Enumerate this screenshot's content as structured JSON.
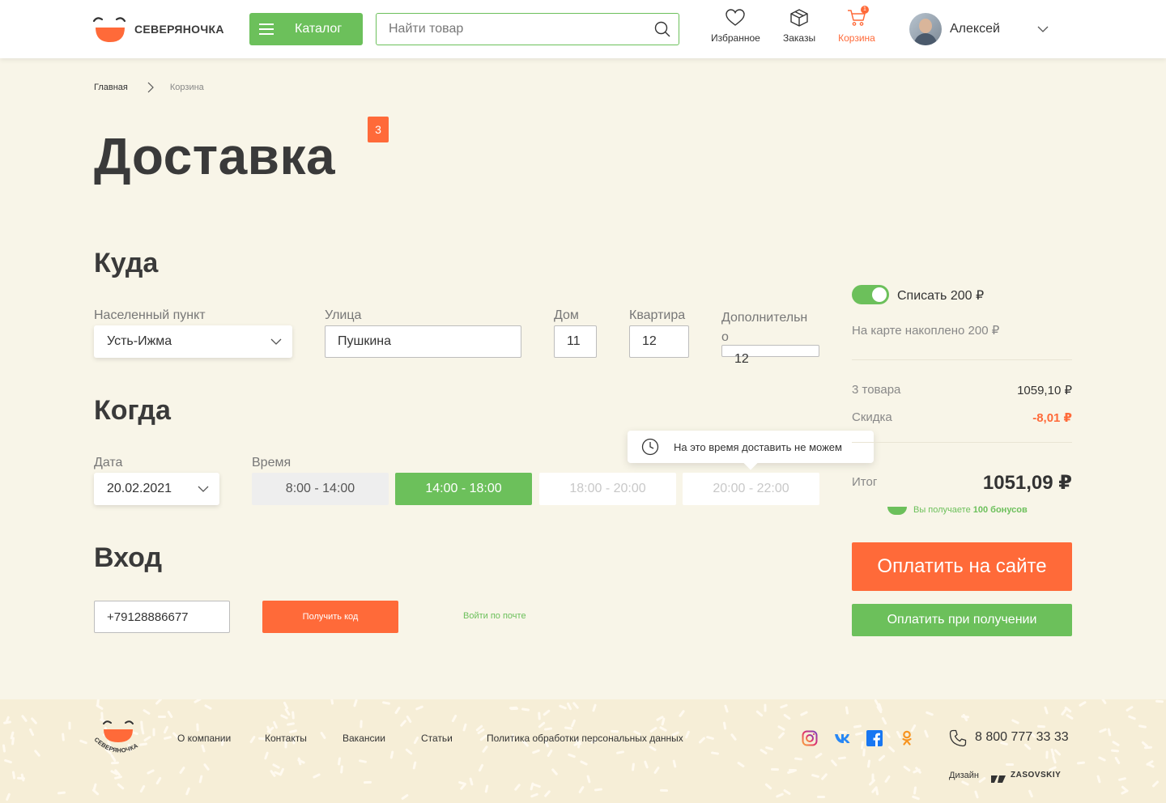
{
  "header": {
    "logo_text": "СЕВЕРЯНОЧКА",
    "catalog_label": "Каталог",
    "search_placeholder": "Найти товар",
    "nav": {
      "favorites": "Избранное",
      "orders": "Заказы",
      "cart": "Корзина",
      "cart_count": "1"
    },
    "user_name": "Алексей"
  },
  "breadcrumb": {
    "home": "Главная",
    "current": "Корзина"
  },
  "page": {
    "title": "Доставка",
    "badge": "3"
  },
  "where": {
    "heading": "Куда",
    "city_label": "Населенный пункт",
    "city_value": "Усть-Ижма",
    "street_label": "Улица",
    "street_value": "Пушкина",
    "house_label": "Дом",
    "house_value": "11",
    "apt_label": "Квартира",
    "apt_value": "12",
    "extra_label_1": "Дополнительн",
    "extra_label_2": "о",
    "extra_value": "12"
  },
  "when": {
    "heading": "Когда",
    "date_label": "Дата",
    "date_value": "20.02.2021",
    "time_label": "Время",
    "slots": [
      "8:00 - 14:00",
      "14:00 - 18:00",
      "18:00 - 20:00",
      "20:00 - 22:00"
    ],
    "tooltip": "На это время доставить не можем"
  },
  "login": {
    "heading": "Вход",
    "phone_value": "+79128886677",
    "get_code": "Получить код",
    "by_email": "Войти по почте"
  },
  "summary": {
    "toggle_label": "Списать 200 ₽",
    "toggle_on": true,
    "accumulated": "На карте накоплено 200 ₽",
    "items_label": "3 товара",
    "items_value": "1059,10  ₽",
    "discount_label": "Скидка",
    "discount_value": "-8,01 ₽",
    "total_label": "Итог",
    "total_value": "1051,09 ₽",
    "bonus_text": "Вы получаете ",
    "bonus_amount": "100 бонусов",
    "pay_online": "Оплатить на сайте",
    "pay_on_delivery": "Оплатить при получении"
  },
  "footer": {
    "logo_text": "СЕВЕРЯНОЧКА",
    "links": [
      "О компании",
      "Контакты",
      "Вакансии",
      "Статьи",
      "Политика обработки персональных данных"
    ],
    "phone": "8 800 777 33 33",
    "design_label": "Дизайн",
    "design_brand": "ZASOVSKIY"
  },
  "colors": {
    "green": "#6cc05b",
    "orange": "#ff6a39",
    "background": "#f8f5e8",
    "footer_bg": "#f6eed7"
  },
  "icons": [
    "smile-logo-icon",
    "burger-icon",
    "search-icon",
    "heart-icon",
    "box-icon",
    "cart-icon",
    "chevron-down-icon",
    "chevron-right-icon",
    "clock-icon",
    "instagram-icon",
    "vk-icon",
    "facebook-icon",
    "ok-icon",
    "phone-icon"
  ]
}
